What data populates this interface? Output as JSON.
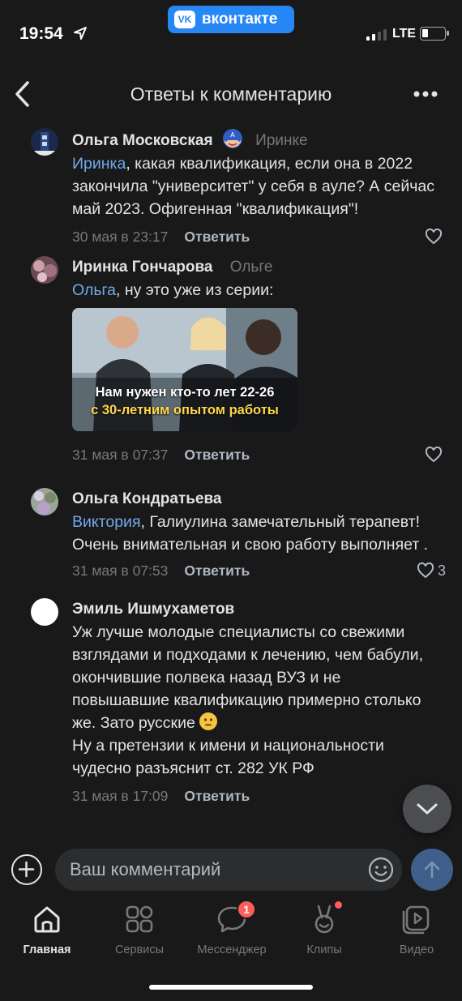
{
  "status_bar": {
    "time": "19:54",
    "app_pill": "вконтакте",
    "app_pill_logo": "VK",
    "network": "LTE"
  },
  "header": {
    "title": "Ответы к комментарию"
  },
  "comments": [
    {
      "author": "Ольга Московская",
      "reply_to": "Иринке",
      "mention": "Иринка",
      "text": ", какая квалификация, если она в 2022 закончила \"университет\" у себя в ауле? А сейчас май 2023. Офигенная \"квалификация\"!",
      "date": "30 мая в 23:17",
      "reply_label": "Ответить",
      "likes": ""
    },
    {
      "author": "Иринка Гончарова",
      "reply_to": "Ольге",
      "mention": "Ольга",
      "text": ", ну это уже из серии:",
      "attachment": {
        "line1": "Нам нужен кто-то лет 22-26",
        "line2": "с 30-летним опытом работы"
      },
      "date": "31 мая в 07:37",
      "reply_label": "Ответить",
      "likes": ""
    },
    {
      "author": "Ольга Кондратьева",
      "reply_to": "",
      "mention": "Виктория",
      "text": ", Галиулина замечательный терапевт! Очень внимательная и свою работу выполняет .",
      "date": "31 мая в 07:53",
      "reply_label": "Ответить",
      "likes": "3"
    },
    {
      "author": "Эмиль Ишмухаметов",
      "reply_to": "",
      "mention": "",
      "text": "Уж лучше молодые специалисты со свежими взглядами и подходами к лечению, чем бабули, окончившие полвека назад ВУЗ и не повышавшие квалификацию примерно столько же. Зато русские",
      "text2": "Ну а претензии к имени и национальности чудесно разъяснит ст. 282 УК РФ",
      "date": "31 мая в 17:09",
      "reply_label": "Ответить",
      "likes": ""
    }
  ],
  "composer": {
    "placeholder": "Ваш комментарий"
  },
  "tabbar": {
    "items": [
      {
        "label": "Главная",
        "icon": "home-icon",
        "active": true
      },
      {
        "label": "Сервисы",
        "icon": "services-icon"
      },
      {
        "label": "Мессенджер",
        "icon": "messenger-icon",
        "badge": "1"
      },
      {
        "label": "Клипы",
        "icon": "clips-icon"
      },
      {
        "label": "Видео",
        "icon": "video-icon"
      }
    ]
  },
  "colors": {
    "background": "#19191a",
    "link": "#71aaeb",
    "accent": "#2787f5",
    "badge": "#ff5c5c"
  }
}
